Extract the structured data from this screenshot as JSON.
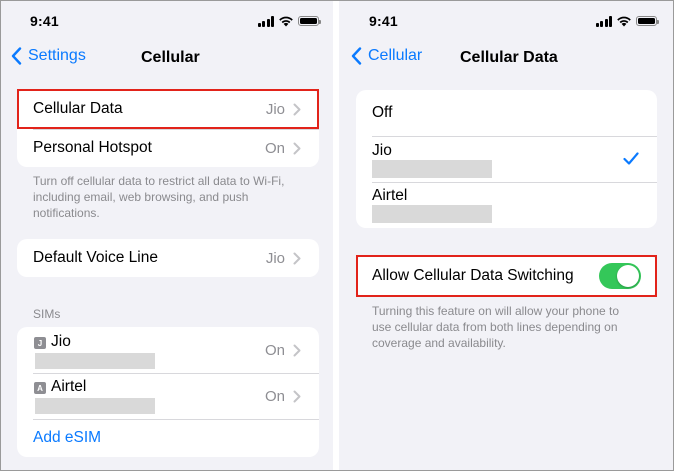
{
  "left": {
    "status": {
      "time": "9:41"
    },
    "nav": {
      "back_label": "Settings",
      "title": "Cellular"
    },
    "group1": {
      "rows": [
        {
          "label": "Cellular Data",
          "value": "Jio"
        },
        {
          "label": "Personal Hotspot",
          "value": "On"
        }
      ]
    },
    "footnote1": {
      "line1": "Turn off cellular data to restrict all data to Wi-Fi,",
      "line2": "including email, web browsing, and push",
      "line3": "notifications."
    },
    "group2": {
      "label": "Default Voice Line",
      "value": "Jio"
    },
    "sims": {
      "header": "SIMs",
      "items": [
        {
          "badge": "J",
          "name": "Jio",
          "value": "On"
        },
        {
          "badge": "A",
          "name": "Airtel",
          "value": "On"
        }
      ],
      "add_label": "Add eSIM"
    }
  },
  "right": {
    "status": {
      "time": "9:41"
    },
    "nav": {
      "back_label": "Cellular",
      "title": "Cellular Data"
    },
    "options": [
      {
        "label": "Off"
      },
      {
        "label": "Jio",
        "checked": true
      },
      {
        "label": "Airtel"
      }
    ],
    "switching": {
      "label": "Allow Cellular Data Switching",
      "on": true
    },
    "footnote": {
      "line1": "Turning this feature on will allow your phone to",
      "line2": "use cellular data from both lines depending on",
      "line3": "coverage and availability."
    }
  },
  "colors": {
    "accent": "#0a7aff",
    "toggle_on": "#34c759",
    "highlight": "#e2231a",
    "background": "#f2f2f7"
  }
}
